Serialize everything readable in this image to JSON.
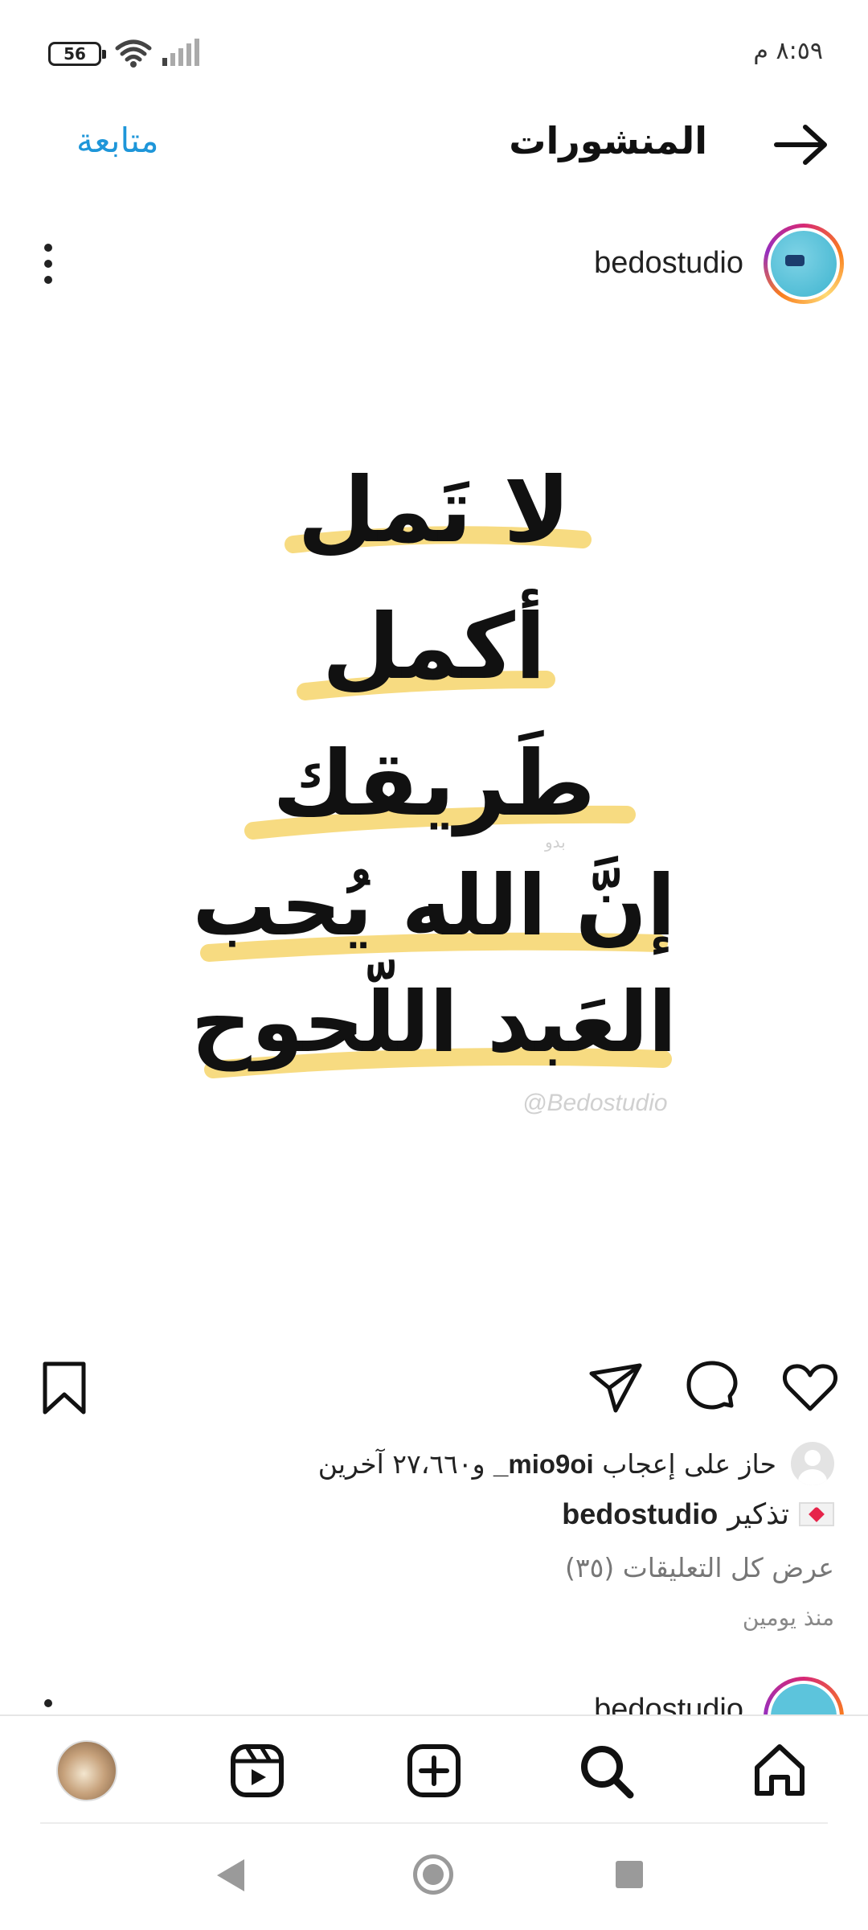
{
  "status_bar": {
    "time": "٨:٥٩ م",
    "battery": "56",
    "icons": [
      "battery-icon",
      "wifi-icon",
      "signal-icon"
    ]
  },
  "header": {
    "title": "المنشورات",
    "follow_label": "متابعة",
    "back_icon": "arrow-right-icon"
  },
  "post": {
    "username": "bedostudio",
    "image": {
      "lines": [
        "لا تَمل",
        "أكمل",
        "طَريقك",
        "إنَّ الله يُحب",
        "العَبد اللّحوح"
      ],
      "watermark": "@Bedostudio",
      "watermark_small": "بدو",
      "highlight_color": "#f6d56b"
    },
    "actions": {
      "like_icon": "heart-icon",
      "comment_icon": "comment-icon",
      "share_icon": "send-icon",
      "save_icon": "bookmark-icon"
    },
    "likes": {
      "prefix": "حاز على إعجاب",
      "user": "mio9oi_",
      "suffix": "و٢٧،٦٦٠ آخرين"
    },
    "caption": {
      "user": "bedostudio",
      "text": "تذكير"
    },
    "view_comments": "عرض كل التعليقات (٣٥)",
    "time_ago": "منذ يومين"
  },
  "next_post": {
    "username": "bedostudio"
  },
  "bottom_nav": {
    "items": [
      "home-icon",
      "search-icon",
      "add-post-icon",
      "reels-icon",
      "profile-avatar"
    ]
  },
  "colors": {
    "accent": "#1e96d9",
    "text": "#111111",
    "muted": "#777777"
  }
}
